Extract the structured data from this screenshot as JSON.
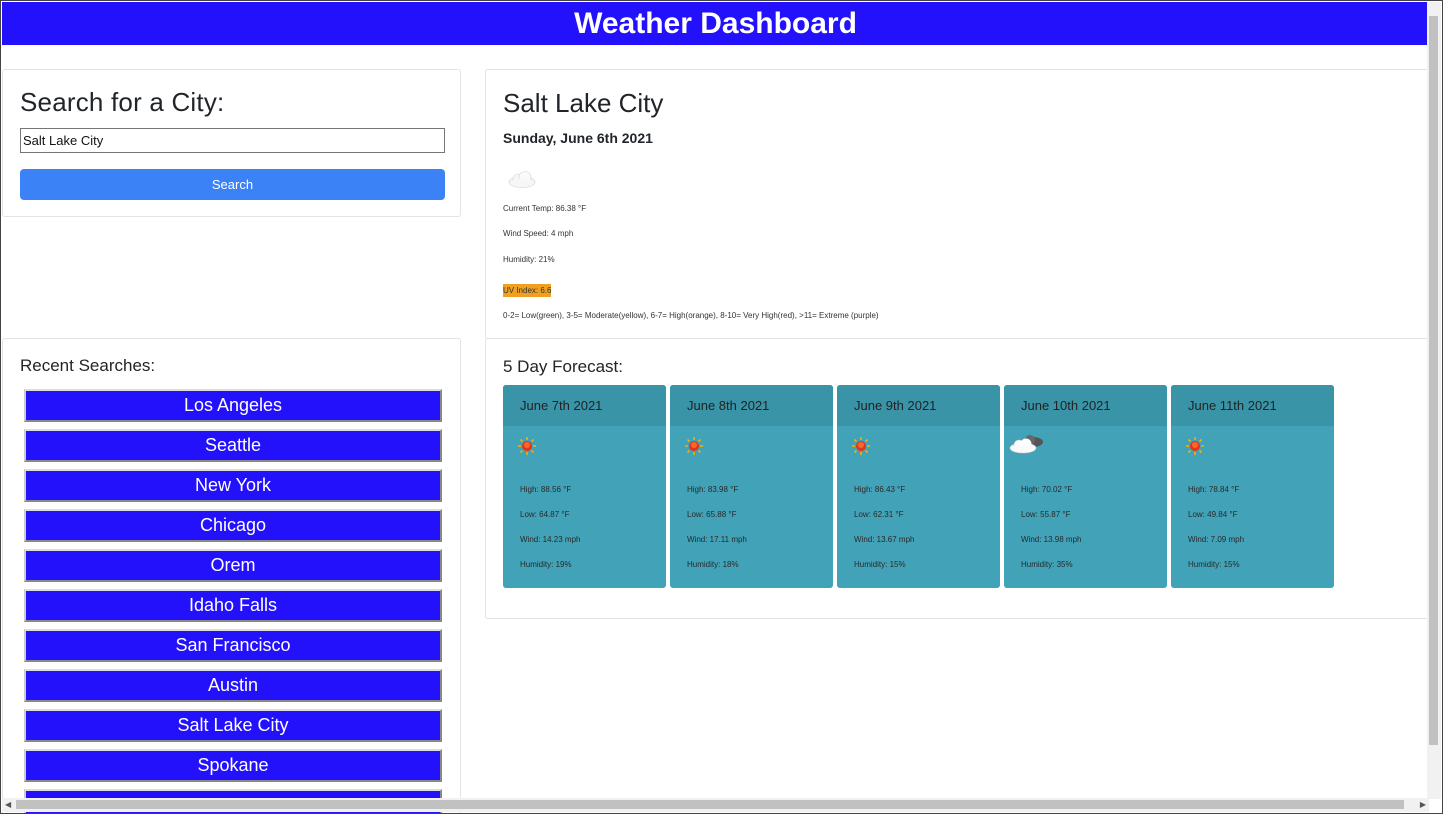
{
  "header": {
    "title": "Weather Dashboard"
  },
  "search": {
    "heading": "Search for a City:",
    "value": "Salt Lake City",
    "button": "Search"
  },
  "recent": {
    "heading": "Recent Searches:",
    "items": [
      "Los Angeles",
      "Seattle",
      "New York",
      "Chicago",
      "Orem",
      "Idaho Falls",
      "San Francisco",
      "Austin",
      "Salt Lake City",
      "Spokane"
    ]
  },
  "current": {
    "city": "Salt Lake City",
    "date": "Sunday, June 6th 2021",
    "icon": "cloud-icon",
    "temp": "Current Temp: 86.38 °F",
    "wind": "Wind Speed: 4 mph",
    "humidity": "Humidity: 21%",
    "uv": "UV Index: 6.6",
    "uv_color": "#f0a020",
    "legend": "0-2= Low(green), 3-5= Moderate(yellow), 6-7= High(orange), 8-10= Very High(red), >11= Extreme (purple)"
  },
  "forecast": {
    "title": "5 Day Forecast:",
    "days": [
      {
        "date": "June 7th 2021",
        "icon": "sun-icon",
        "high": "High: 88.56 °F",
        "low": "Low: 64.87 °F",
        "wind": "Wind: 14.23 mph",
        "humidity": "Humidity: 19%"
      },
      {
        "date": "June 8th 2021",
        "icon": "sun-icon",
        "high": "High: 83.98 °F",
        "low": "Low: 65.88 °F",
        "wind": "Wind: 17.11 mph",
        "humidity": "Humidity: 18%"
      },
      {
        "date": "June 9th 2021",
        "icon": "sun-icon",
        "high": "High: 86.43 °F",
        "low": "Low: 62.31 °F",
        "wind": "Wind: 13.67 mph",
        "humidity": "Humidity: 15%"
      },
      {
        "date": "June 10th 2021",
        "icon": "partly-cloudy-icon",
        "high": "High: 70.02 °F",
        "low": "Low: 55.87 °F",
        "wind": "Wind: 13.98 mph",
        "humidity": "Humidity: 35%"
      },
      {
        "date": "June 11th 2021",
        "icon": "sun-icon",
        "high": "High: 78.84 °F",
        "low": "Low: 49.84 °F",
        "wind": "Wind: 7.09 mph",
        "humidity": "Humidity: 15%"
      }
    ]
  },
  "colors": {
    "brand": "#2311fc",
    "search_button": "#3b82f6",
    "forecast_card": "#41a2b8"
  }
}
